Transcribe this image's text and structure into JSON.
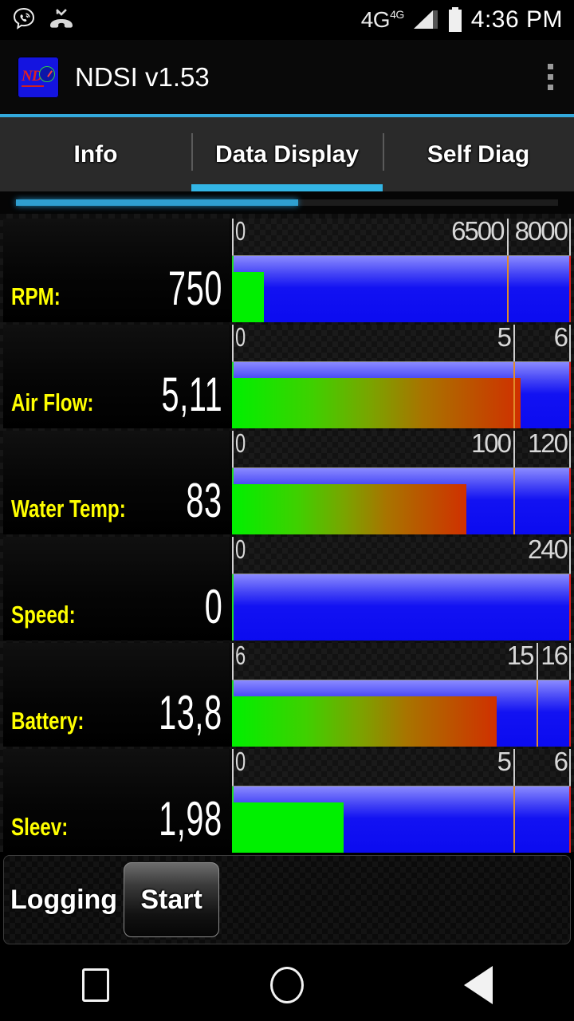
{
  "statusbar": {
    "icons": [
      "viber-icon",
      "missed-call-icon"
    ],
    "network": "4G",
    "network_sup": "4G",
    "signal": "signal-bars-icon",
    "battery": "battery-full-icon",
    "time": "4:36 PM"
  },
  "actionbar": {
    "app_icon_text": "NDS",
    "title": "NDSI v1.53",
    "overflow": "overflow-menu-icon",
    "accent": "#33a9dc"
  },
  "tabs": {
    "items": [
      {
        "label": "Info",
        "active": false
      },
      {
        "label": "Data Display",
        "active": true
      },
      {
        "label": "Self Diag",
        "active": false
      }
    ],
    "indicator_color": "#33b5e5"
  },
  "progress": {
    "percent": 52,
    "color": "#2f9fd0"
  },
  "rows": [
    {
      "name": "RPM:",
      "value": "750",
      "scale_min": "0",
      "scale_warn": "6500",
      "scale_max": "8000",
      "min": 0,
      "max": 8000,
      "warn": 6500,
      "current": 750,
      "fill_percent": 9.4,
      "warn_percent": 81.3,
      "gradient": false
    },
    {
      "name": "Air Flow:",
      "value": "5,11",
      "scale_min": "0",
      "scale_warn": "5",
      "scale_max": "6",
      "min": 0,
      "max": 6,
      "warn": 5,
      "current": 5.11,
      "fill_percent": 85.2,
      "warn_percent": 83.3,
      "gradient": true
    },
    {
      "name": "Water Temp:",
      "value": "83",
      "scale_min": "0",
      "scale_warn": "100",
      "scale_max": "120",
      "min": 0,
      "max": 120,
      "warn": 100,
      "current": 83,
      "fill_percent": 69.2,
      "warn_percent": 83.3,
      "gradient": true
    },
    {
      "name": "Speed:",
      "value": "0",
      "scale_min": "0",
      "scale_warn": "",
      "scale_max": "240",
      "min": 0,
      "max": 240,
      "warn": null,
      "current": 0,
      "fill_percent": 0,
      "warn_percent": null,
      "gradient": false
    },
    {
      "name": "Battery:",
      "value": "13,8",
      "scale_min": "6",
      "scale_warn": "15",
      "scale_max": "16",
      "min": 6,
      "max": 16,
      "warn": 15,
      "current": 13.8,
      "fill_percent": 78.0,
      "warn_percent": 90.0,
      "gradient": true
    },
    {
      "name": "Sleev:",
      "value": "1,98",
      "scale_min": "0",
      "scale_warn": "5",
      "scale_max": "6",
      "min": 0,
      "max": 6,
      "warn": 5,
      "current": 1.98,
      "fill_percent": 33.0,
      "warn_percent": 83.3,
      "gradient": false
    }
  ],
  "controls": {
    "logging_label": "Logging",
    "start_label": "Start"
  },
  "navbar": {
    "recent": "recents-square-icon",
    "home": "home-circle-icon",
    "back": "back-triangle-icon"
  },
  "colors": {
    "label": "#ffff00",
    "value": "#ffffff",
    "bar_blue": "#1212f2",
    "fill_green": "#00f000",
    "fill_red": "#d03000",
    "warn_tick": "#e08b2a",
    "right_edge": "#e02020"
  }
}
